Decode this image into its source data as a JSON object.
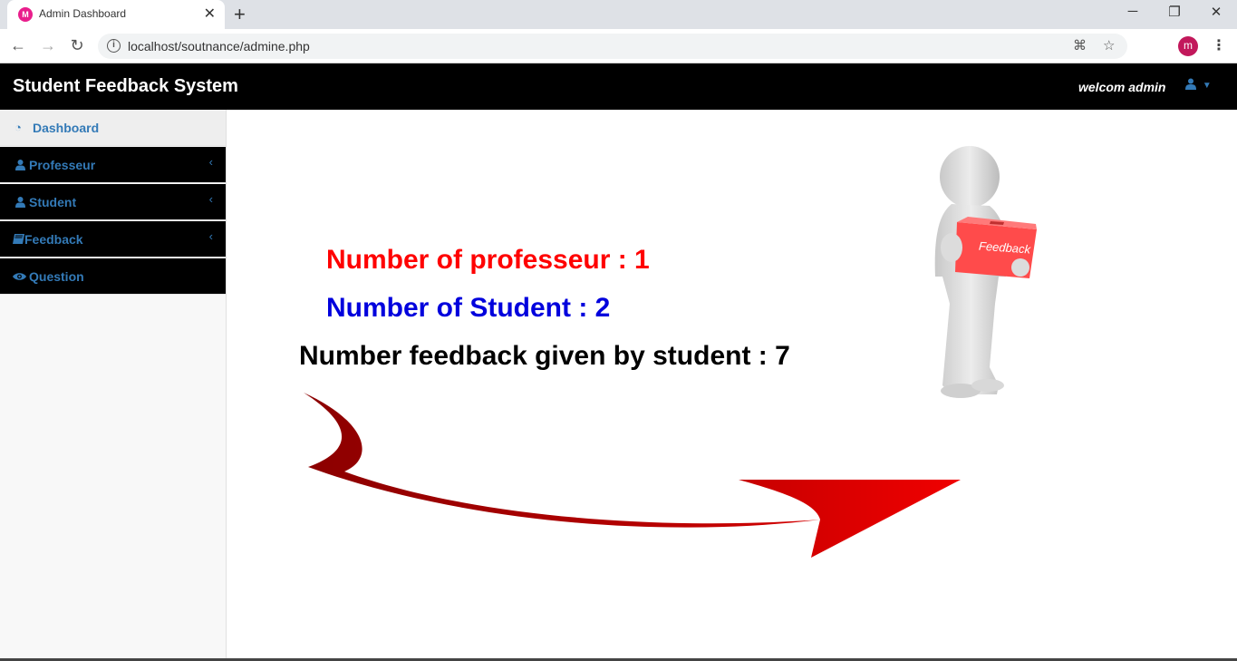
{
  "browser": {
    "tab_title": "Admin Dashboard",
    "favicon_letter": "M",
    "url": "localhost/soutnance/admine.php",
    "profile_initial": "m"
  },
  "header": {
    "brand": "Student Feedback System",
    "welcome": "welcom admin"
  },
  "sidebar": {
    "items": [
      {
        "label": "Dashboard",
        "icon": "dashboard-icon"
      },
      {
        "label": "Professeur",
        "icon": "user-icon"
      },
      {
        "label": "Student",
        "icon": "user-icon"
      },
      {
        "label": "Feedback",
        "icon": "book-icon"
      },
      {
        "label": "Question",
        "icon": "eye-icon"
      }
    ]
  },
  "stats": {
    "professeur": "Number of professeur : 1",
    "student": "Number of Student : 2",
    "feedback": "Number feedback given by student : 7"
  },
  "illustration": {
    "box_label": "Feedback"
  },
  "colors": {
    "professeur_stat": "#ff0000",
    "student_stat": "#0000dd",
    "sidebar_link": "#337ab7",
    "arrow": "#cc0000"
  }
}
